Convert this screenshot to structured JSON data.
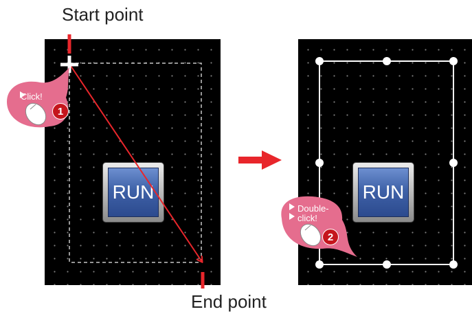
{
  "labels": {
    "start_point": "Start point",
    "end_point": "End point"
  },
  "left_panel": {
    "button_label": "RUN",
    "bubble": {
      "text": "Click!",
      "step": "1"
    }
  },
  "right_panel": {
    "button_label": "RUN",
    "bubble": {
      "text_line1": "Double-",
      "text_line2": "click!",
      "step": "2"
    }
  },
  "icons": [
    "crosshair-icon",
    "mouse-icon",
    "arrow-right-icon"
  ],
  "colors": {
    "accent_red": "#e8262b",
    "bubble_pink": "#e56d8e",
    "panel_bg": "#000000",
    "button_blue": "#3f62a8"
  }
}
